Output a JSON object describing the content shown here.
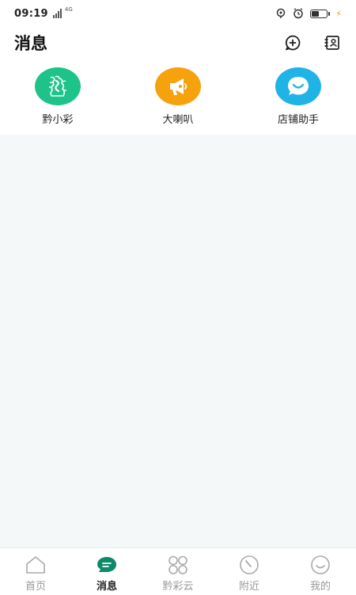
{
  "status_bar": {
    "time": "09:19",
    "network": "4G",
    "battery_level": 0.55,
    "icons": [
      "location-icon",
      "alarm-icon",
      "battery-icon",
      "charging-icon"
    ]
  },
  "header": {
    "title": "消息",
    "actions": [
      "add-chat-icon",
      "contacts-icon"
    ]
  },
  "shortcuts": [
    {
      "label": "黔小彩",
      "icon": "brand-logo-icon",
      "color": "#1ec38a"
    },
    {
      "label": "大喇叭",
      "icon": "megaphone-icon",
      "color": "#f5a20d"
    },
    {
      "label": "店铺助手",
      "icon": "smile-chat-icon",
      "color": "#1fb3e6"
    }
  ],
  "content": {
    "background": "#f4f8f8"
  },
  "bottom_nav": {
    "active_index": 1,
    "active_color": "#0e8a6a",
    "items": [
      {
        "label": "首页",
        "icon": "home-icon"
      },
      {
        "label": "消息",
        "icon": "message-icon"
      },
      {
        "label": "黔彩云",
        "icon": "grid-icon"
      },
      {
        "label": "附近",
        "icon": "compass-icon"
      },
      {
        "label": "我的",
        "icon": "smile-icon"
      }
    ]
  }
}
